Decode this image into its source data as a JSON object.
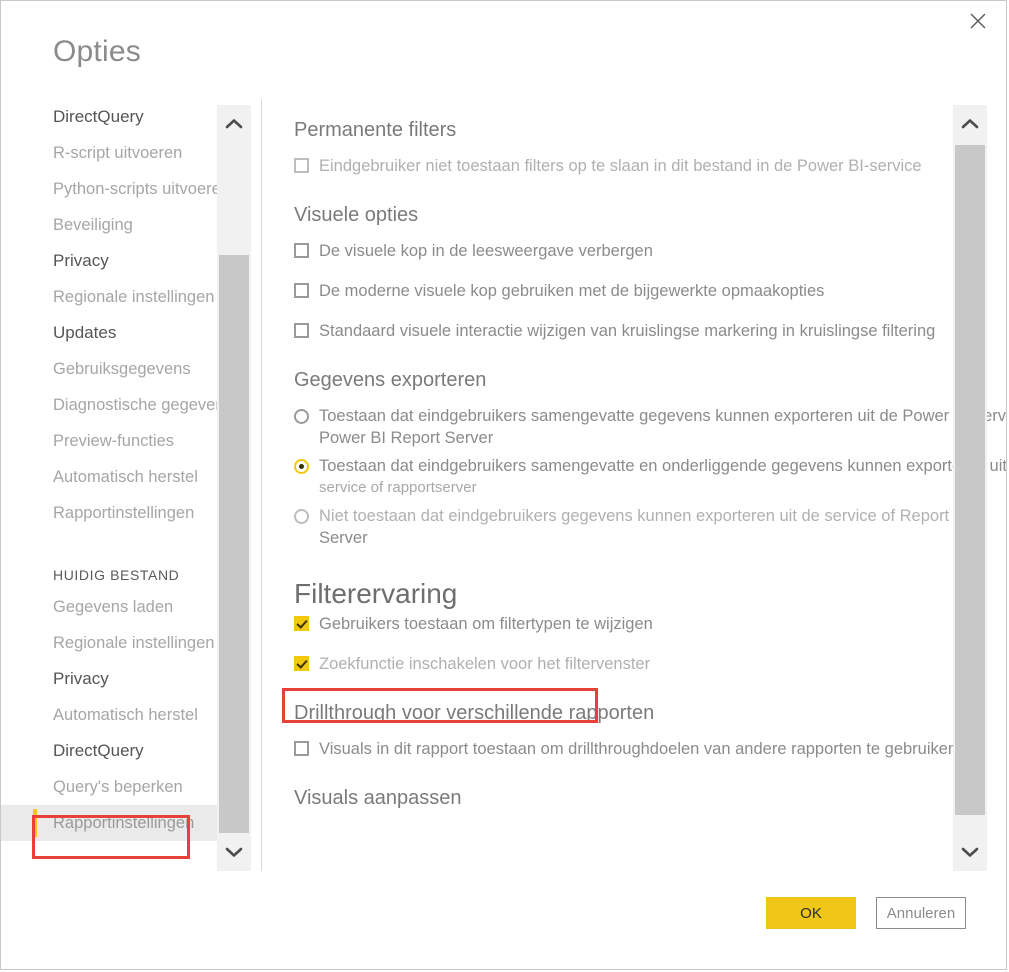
{
  "window": {
    "title": "Opties",
    "close_icon": "close-icon"
  },
  "sidebar": {
    "scroll": {
      "up_icon": "chevron-up-icon",
      "down_icon": "chevron-down-icon"
    },
    "items": [
      {
        "label": "DirectQuery",
        "style": "strong"
      },
      {
        "label": "R-script uitvoeren",
        "style": "normal"
      },
      {
        "label": "Python-scripts uitvoeren",
        "style": "normal"
      },
      {
        "label": "Beveiliging",
        "style": "normal"
      },
      {
        "label": "Privacy",
        "style": "strong"
      },
      {
        "label": "Regionale instellingen",
        "style": "normal"
      },
      {
        "label": "Updates",
        "style": "strong"
      },
      {
        "label": "Gebruiksgegevens",
        "style": "normal"
      },
      {
        "label": "Diagnostische gegevens",
        "style": "normal"
      },
      {
        "label": "Preview-functies",
        "style": "normal"
      },
      {
        "label": "Automatisch herstel",
        "style": "normal"
      },
      {
        "label": "Rapportinstellingen",
        "style": "normal"
      },
      {
        "label": "HUIDIG BESTAND",
        "style": "section"
      },
      {
        "label": "Gegevens laden",
        "style": "normal"
      },
      {
        "label": "Regionale instellingen",
        "style": "normal"
      },
      {
        "label": "Privacy",
        "style": "strong"
      },
      {
        "label": "Automatisch herstel",
        "style": "normal"
      },
      {
        "label": "DirectQuery",
        "style": "strong"
      },
      {
        "label": "Query's beperken",
        "style": "normal"
      },
      {
        "label": "Rapportinstellingen",
        "style": "selected"
      }
    ]
  },
  "content": {
    "scroll": {
      "up_icon": "chevron-up-icon",
      "down_icon": "chevron-down-icon"
    },
    "sections": [
      {
        "heading": "Permanente filters",
        "checkboxes": [
          {
            "label": "Eindgebruiker niet toestaan filters op te slaan in dit bestand in de Power BI-service",
            "checked": false,
            "dim": true
          }
        ]
      },
      {
        "heading": "Visuele opties",
        "checkboxes": [
          {
            "label": "De visuele kop in de leesweergave verbergen",
            "checked": false,
            "dim": false
          },
          {
            "label": "De moderne visuele kop gebruiken met de bijgewerkte opmaakopties",
            "checked": false,
            "dim": false
          },
          {
            "label": "Standaard visuele interactie wijzigen van kruislingse markering in kruislingse filtering",
            "checked": false,
            "dim": false
          }
        ]
      },
      {
        "heading": "Gegevens exporteren",
        "radios": [
          {
            "label": "Toestaan dat eindgebruikers samengevatte gegevens kunnen exporteren uit de Power BI-service of",
            "sub": "Power BI Report Server",
            "checked": false,
            "dim": false
          },
          {
            "label": "Toestaan dat eindgebruikers samengevatte en onderliggende gegevens kunnen exporteren uit de",
            "sub": "service of rapportserver",
            "checked": true,
            "dim": false
          },
          {
            "label": "Niet toestaan dat eindgebruikers gegevens kunnen exporteren uit de service of Report",
            "sub": "Server",
            "checked": false,
            "dim": true
          }
        ]
      },
      {
        "heading": "Filterervaring",
        "checkboxes": [
          {
            "label": "Gebruikers toestaan om filtertypen te wijzigen",
            "checked": true,
            "dim": false
          },
          {
            "label": "Zoekfunctie inschakelen voor het filtervenster",
            "checked": true,
            "dim": true
          }
        ]
      },
      {
        "heading": "Drillthrough voor verschillende rapporten",
        "checkboxes": [
          {
            "label": "Visuals in dit rapport toestaan om drillthroughdoelen van andere rapporten te gebruiken",
            "checked": false,
            "dim": false
          }
        ]
      },
      {
        "heading": "Visuals aanpassen",
        "checkboxes": []
      }
    ]
  },
  "footer": {
    "ok_label": "OK",
    "cancel_label": "Annuleren"
  },
  "annotations": {
    "accent_color": "#f2c811",
    "highlight_color": "#e8413a",
    "sidebar_target": "Rapportinstellingen",
    "content_target": "Zoekfunctie inschakelen voor het filtervenster"
  }
}
